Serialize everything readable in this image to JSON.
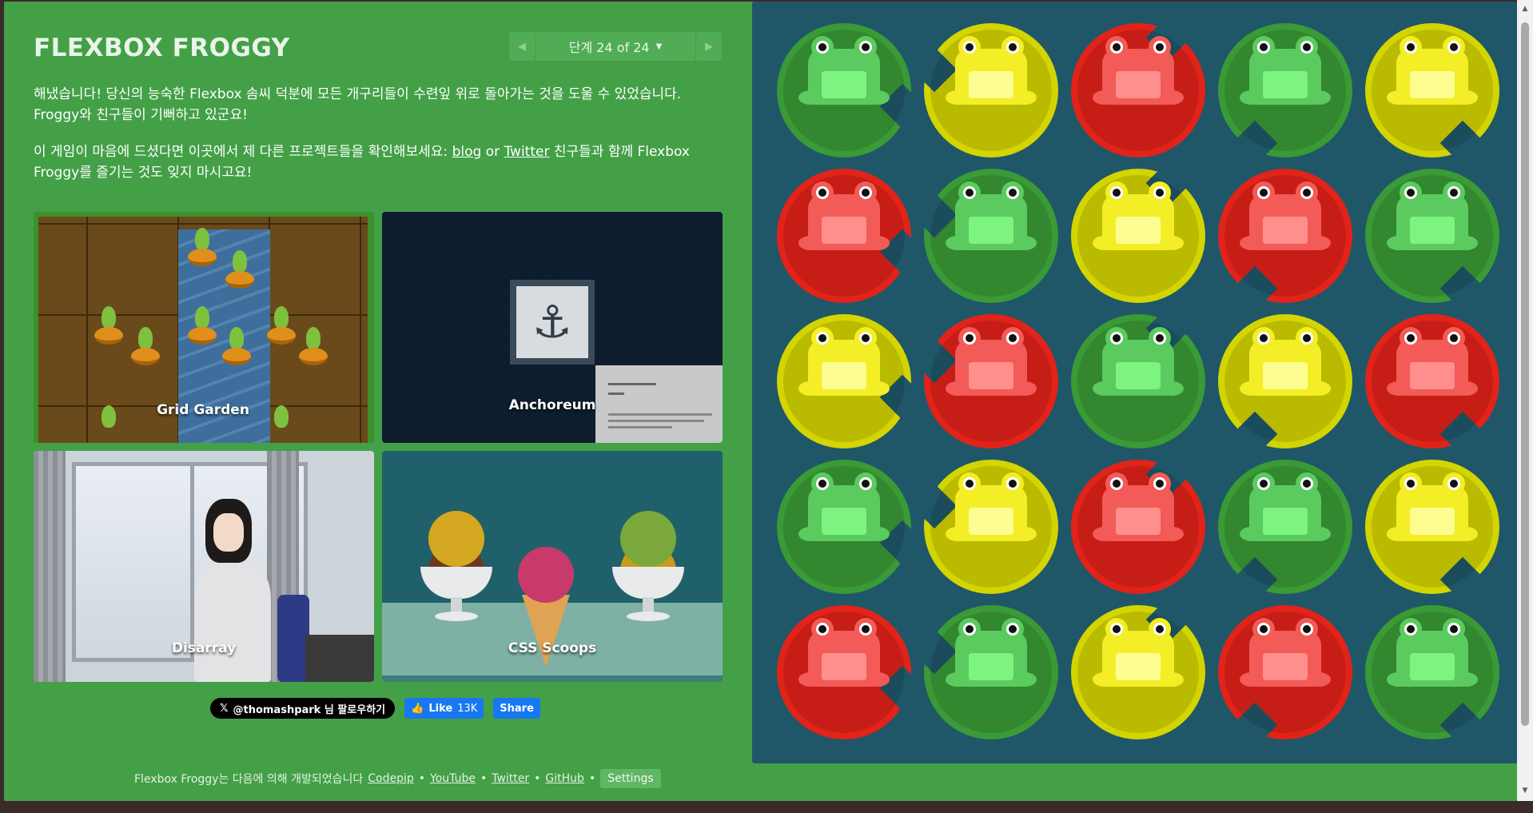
{
  "app": {
    "logo": "FLEXBOX FROGGY",
    "level_indicator": "단계 24 of 24",
    "prev_icon": "triangle-left-icon",
    "next_icon": "triangle-right-icon"
  },
  "instructions": {
    "p1": "해냈습니다! 당신의 능숙한 Flexbox 솜씨 덕분에 모든 개구리들이 수련잎 위로 돌아가는 것을 도울 수 있었습니다. Froggy와 친구들이 기뻐하고 있군요!",
    "p2_before": "이 게임이 마음에 드셨다면 이곳에서 제 다른 프로젝트들을 확인해보세요: ",
    "p2_blog": "blog",
    "p2_or": " or ",
    "p2_twitter": "Twitter",
    "p2_after": " 친구들과 함께 Flexbox Froggy를 즐기는 것도 잊지 마시고요!"
  },
  "projects": [
    {
      "label": "Grid Garden"
    },
    {
      "label": "Anchoreum"
    },
    {
      "label": "Disarray"
    },
    {
      "label": "CSS Scoops"
    }
  ],
  "social": {
    "x_follow": "@thomashpark 님 팔로우하기",
    "fb_like": "Like",
    "fb_count": "13K",
    "fb_share": "Share"
  },
  "footer": {
    "text": "Flexbox Froggy는 다음에 의해 개발되었습니다",
    "links": [
      "Codepip",
      "YouTube",
      "Twitter",
      "GitHub"
    ],
    "separator": "•",
    "settings": "Settings"
  },
  "colors": {
    "green": "#3a9a36",
    "yellow": "#d4d500",
    "red": "#e2231a",
    "board_bg": "#1f5768",
    "sidebar_bg": "#43a047"
  },
  "board": {
    "rows": [
      [
        "green",
        "yellow",
        "red",
        "green",
        "yellow"
      ],
      [
        "red",
        "green",
        "yellow",
        "red",
        "green"
      ],
      [
        "yellow",
        "red",
        "green",
        "yellow",
        "red"
      ],
      [
        "green",
        "yellow",
        "red",
        "green",
        "yellow"
      ],
      [
        "red",
        "green",
        "yellow",
        "red",
        "green"
      ]
    ]
  }
}
